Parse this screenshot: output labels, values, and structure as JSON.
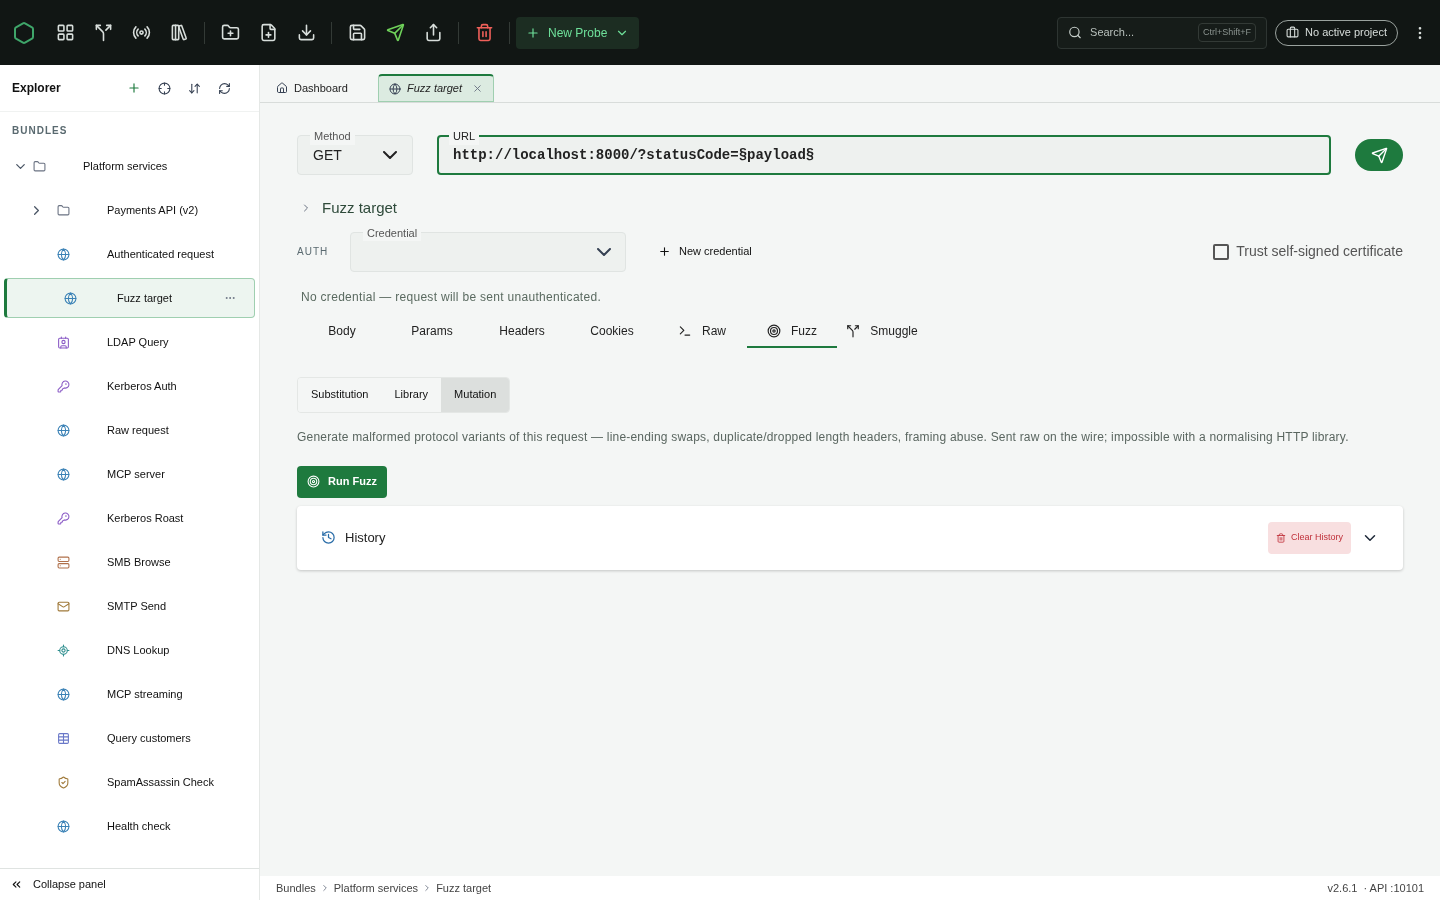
{
  "topbar": {
    "new_probe": "New Probe",
    "search": {
      "placeholder": "Search...",
      "shortcut": "Ctrl+Shift+F"
    },
    "project": "No active project"
  },
  "explorer": {
    "title": "Explorer",
    "section": "BUNDLES",
    "tree": [
      {
        "label": "Platform services",
        "kind": "folder",
        "expanded": true,
        "selected": false,
        "children": [
          {
            "label": "Payments API (v2)",
            "kind": "folder",
            "expanded": false,
            "selected": false
          },
          {
            "label": "Authenticated request",
            "kind": "http",
            "selected": false
          },
          {
            "label": "Fuzz target",
            "kind": "http",
            "selected": true
          },
          {
            "label": "LDAP Query",
            "kind": "ldap",
            "selected": false
          },
          {
            "label": "Kerberos Auth",
            "kind": "kerberos",
            "selected": false
          },
          {
            "label": "Raw request",
            "kind": "http",
            "selected": false
          },
          {
            "label": "MCP server",
            "kind": "http",
            "selected": false
          },
          {
            "label": "Kerberos Roast",
            "kind": "kerberos",
            "selected": false
          },
          {
            "label": "SMB Browse",
            "kind": "smb",
            "selected": false
          },
          {
            "label": "SMTP Send",
            "kind": "smtp",
            "selected": false
          },
          {
            "label": "DNS Lookup",
            "kind": "dns",
            "selected": false
          },
          {
            "label": "MCP streaming",
            "kind": "http",
            "selected": false
          },
          {
            "label": "Query customers",
            "kind": "sql",
            "selected": false
          },
          {
            "label": "SpamAssassin Check",
            "kind": "spam",
            "selected": false
          },
          {
            "label": "Health check",
            "kind": "http",
            "selected": false
          }
        ]
      }
    ],
    "collapse": "Collapse panel"
  },
  "tabs": [
    {
      "label": "Dashboard",
      "kind": "home",
      "selected": false
    },
    {
      "label": "Fuzz target",
      "kind": "http",
      "selected": true
    }
  ],
  "request": {
    "method": {
      "label": "Method",
      "value": "GET"
    },
    "url": {
      "label": "URL",
      "value": "http://localhost:8000/?statusCode=§payload§"
    },
    "title": "Fuzz target",
    "title_expanded": false,
    "auth": {
      "label": "AUTH",
      "credential_label": "Credential",
      "new_credential": "New credential",
      "trust": {
        "label": "Trust self-signed certificate",
        "checked": false
      },
      "note": "No credential — request will be sent unauthenticated."
    },
    "tabs": [
      {
        "label": "Body",
        "kind": "plain",
        "selected": false
      },
      {
        "label": "Params",
        "kind": "plain",
        "selected": false
      },
      {
        "label": "Headers",
        "kind": "plain",
        "selected": false
      },
      {
        "label": "Cookies",
        "kind": "plain",
        "selected": false
      },
      {
        "label": "Raw",
        "kind": "terminal",
        "selected": false
      },
      {
        "label": "Fuzz",
        "kind": "target",
        "selected": true
      },
      {
        "label": "Smuggle",
        "kind": "split",
        "selected": false
      }
    ],
    "modes": [
      {
        "label": "Substitution",
        "selected": false
      },
      {
        "label": "Library",
        "selected": false
      },
      {
        "label": "Mutation",
        "selected": true
      }
    ],
    "description": "Generate malformed protocol variants of this request — line-ending swaps, duplicate/dropped length headers, framing abuse. Sent raw on the wire; impossible with a normalising HTTP library.",
    "run": "Run Fuzz",
    "history": {
      "title": "History",
      "clear": "Clear History",
      "expanded": false
    }
  },
  "status_bar": {
    "breadcrumbs": [
      "Bundles",
      "Platform services",
      "Fuzz target"
    ],
    "version": "v2.6.1",
    "api": "· API :10101"
  }
}
